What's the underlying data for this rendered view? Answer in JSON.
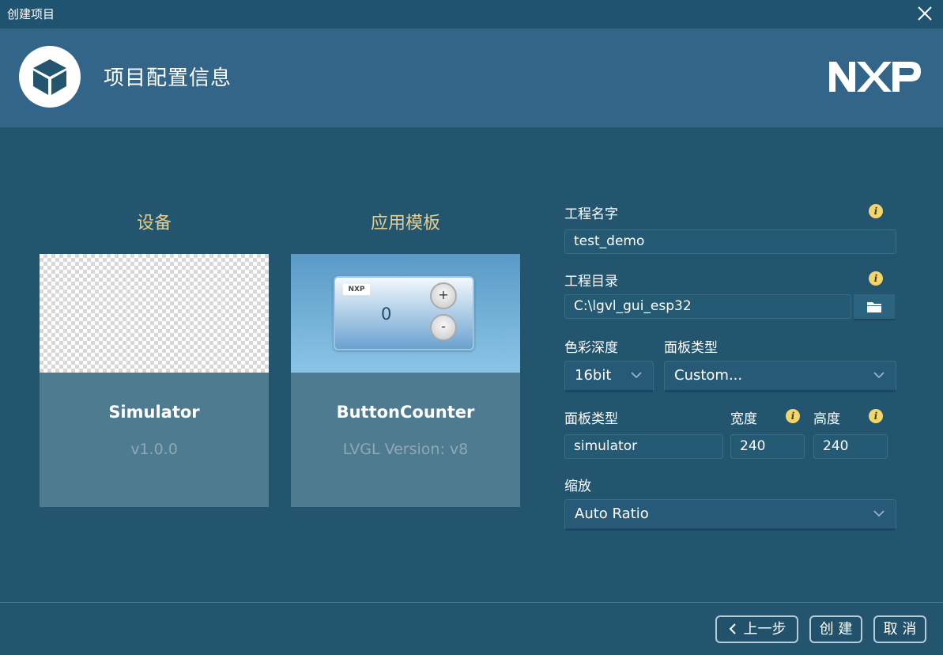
{
  "window": {
    "title": "创建项目"
  },
  "header": {
    "heading": "项目配置信息",
    "brand": "NXP"
  },
  "device": {
    "section_title": "设备",
    "name": "Simulator",
    "version": "v1.0.0"
  },
  "template": {
    "section_title": "应用模板",
    "name": "ButtonCounter",
    "version": "LVGL Version: v8",
    "widget": {
      "logo": "NXP",
      "count": "0",
      "plus": "+",
      "minus": "-"
    }
  },
  "form": {
    "project_name_label": "工程名字",
    "project_name_value": "test_demo",
    "project_dir_label": "工程目录",
    "project_dir_value": "C:\\lgvl_gui_esp32",
    "color_depth_label": "色彩深度",
    "color_depth_value": "16bit",
    "panel_type_label": "面板类型",
    "panel_type_value": "Custom...",
    "panel_type2_label": "面板类型",
    "panel_type2_value": "simulator",
    "width_label": "宽度",
    "width_value": "240",
    "height_label": "高度",
    "height_value": "240",
    "scale_label": "缩放",
    "scale_value": "Auto Ratio"
  },
  "footer": {
    "back_label": "上一步",
    "create_label": "创 建",
    "cancel_label": "取 消"
  },
  "colors": {
    "background": "#23556f",
    "header": "#336588",
    "accent_gold": "#e6cf8c",
    "info": "#f0d66c"
  }
}
